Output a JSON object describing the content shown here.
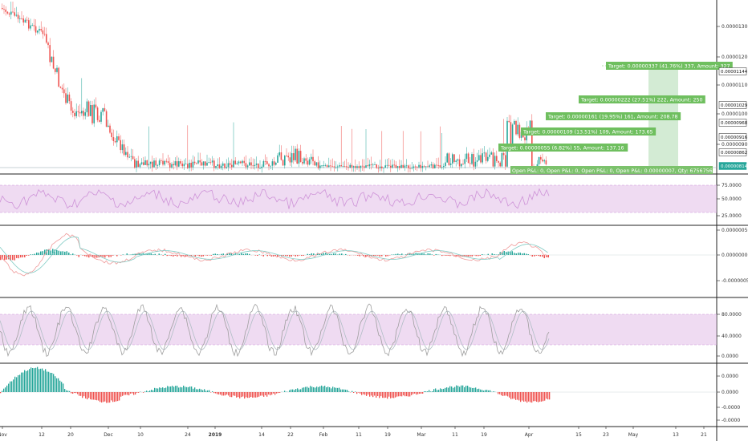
{
  "chart_data": {
    "type": "line",
    "colors": {
      "up": "#26a69a",
      "down": "#ef5350",
      "band_fill": "#e1bee7",
      "band_line": "#ce93d8",
      "line_gray": "#9e9e9e",
      "target_green": "#6fbf5f",
      "target_zone": "#c8e6c9",
      "axis_text": "#333333",
      "pane_border": "#222222",
      "fast_line": "#ef9a9a",
      "slow_line": "#80cbc4"
    },
    "x_axis_labels": [
      "Nov",
      "12",
      "20",
      "Dec",
      "10",
      "24",
      "2019",
      "14",
      "22",
      "Feb",
      "11",
      "19",
      "Mar",
      "11",
      "19",
      "Apr",
      "15",
      "23",
      "May",
      "13",
      "21"
    ],
    "panes": [
      {
        "name": "price",
        "y_labels": [
          "0.00001300",
          "0.00001200",
          "0.00001100",
          "0.00001000",
          "0.00000900"
        ],
        "price_tags": [
          {
            "text": "0.00001144",
            "style": "dark"
          },
          {
            "text": "0.00001029",
            "style": "dark"
          },
          {
            "text": "0.00000968",
            "style": "dark"
          },
          {
            "text": "0.00000916",
            "style": "dark"
          },
          {
            "text": "0.00000862",
            "style": "dark"
          },
          {
            "text": "0.00000814",
            "style": "teal"
          }
        ],
        "targets": [
          "Target: 0.00000337 (41.76%) 337, Amount: 327",
          "Target: 0.00000222 (27.51%) 222, Amount: 250",
          "Target: 0.00000161 (19.95%) 161, Amount: 208.78",
          "Target: 0.00000109 (13.51%) 109, Amount: 173.65",
          "Target: 0.00000055 (6.82%) 55, Amount: 137.16"
        ],
        "open_pnl": "Open P&L: 0, Open P&L: 0, Open P&L: 0, Open P&L: 0.00000007, Qty: 67567567"
      },
      {
        "name": "rsi",
        "y_labels": [
          "75.0000",
          "50.0000",
          "25.0000"
        ]
      },
      {
        "name": "macd",
        "y_labels": [
          "0.00000050",
          "0.00000000",
          "-0.00000050"
        ]
      },
      {
        "name": "stochastic",
        "y_labels": [
          "80.0000",
          "40.0000",
          "0.0000"
        ]
      },
      {
        "name": "histogram",
        "y_labels": [
          "0.0000",
          "0.0000",
          "-0.0000",
          "-0.0000"
        ]
      }
    ]
  }
}
